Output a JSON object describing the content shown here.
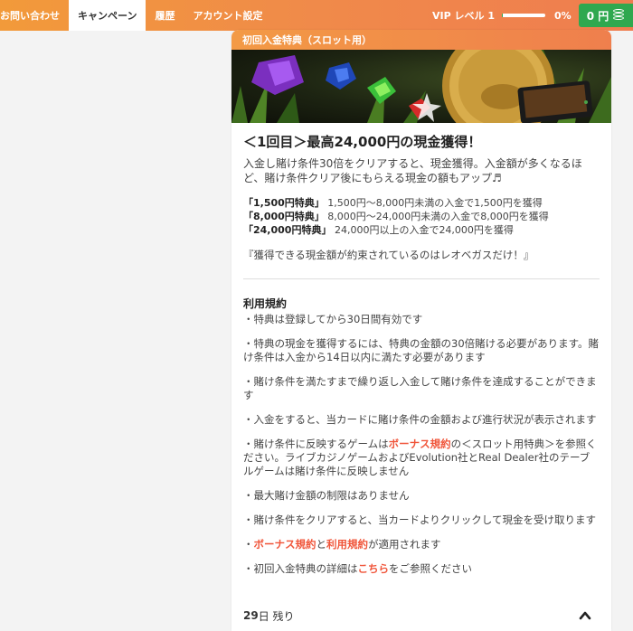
{
  "nav": {
    "items": [
      "お問い合わせ",
      "キャンペーン",
      "履歴",
      "アカウント設定"
    ]
  },
  "vip": {
    "label": "VIP レベル 1",
    "progress_pct": 3,
    "percent_text": "0%"
  },
  "balance": {
    "text": "0 円"
  },
  "card": {
    "header": "初回入金特典（スロット用）",
    "title": "＜1回目＞最高24,000円の現金獲得！",
    "desc": "入金し賭け条件30倍をクリアすると、現金獲得。入金額が多くなるほど、賭け条件クリア後にもらえる現金の額もアップ♬",
    "tiers": [
      {
        "name": "「1,500円特典」",
        "detail": " 1,500円～8,000円未満の入金で1,500円を獲得"
      },
      {
        "name": "「8,000円特典」",
        "detail": " 8,000円～24,000円未満の入金で8,000円を獲得"
      },
      {
        "name": "「24,000円特典」",
        "detail": " 24,000円以上の入金で24,000円を獲得"
      }
    ],
    "quote": "『獲得できる現金額が約束されているのはレオベガスだけ！』",
    "terms_title": "利用規約",
    "terms": [
      "・特典は登録してから30日間有効です",
      "・特典の現金を獲得するには、特典の金額の30倍賭ける必要があります。賭け条件は入金から14日以内に満たす必要があります",
      "・賭け条件を満たすまで繰り返し入金して賭け条件を達成することができます",
      "・入金をすると、当カードに賭け条件の金額および進行状況が表示されます"
    ],
    "term5": {
      "pre": "・賭け条件に反映するゲームは",
      "link": "ボーナス規約",
      "post": "の＜スロット用特典＞を参照ください。ライブカジノゲームおよびEvolution社とReal Dealer社のテーブルゲームは賭け条件に反映しません"
    },
    "term6": "・最大賭け金額の制限はありません",
    "term7": "・賭け条件をクリアすると、当カードよりクリックして現金を受け取ります",
    "term8": {
      "pre": "・",
      "link1": "ボーナス規約",
      "mid": "と",
      "link2": "利用規約",
      "post": "が適用されます"
    },
    "term9": {
      "pre": "・初回入金特典の詳細は",
      "link": "こちら",
      "post": "をご参照ください"
    },
    "footer": {
      "days": "29",
      "suffix": " 日 残り"
    }
  },
  "colors": {
    "accent": "#f08a4a",
    "balance": "#2fa84f",
    "link": "#f0553a"
  },
  "icons": {
    "coins": "coins-icon",
    "collapse": "chevron-up-icon"
  }
}
